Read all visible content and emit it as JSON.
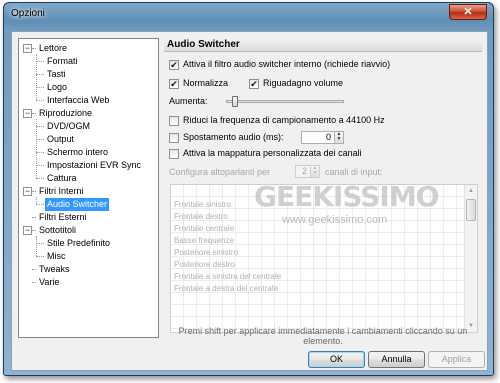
{
  "window": {
    "title": "Opzioni",
    "close_glyph": "✕"
  },
  "tree": {
    "items": [
      {
        "label": "Lettore",
        "level": 0,
        "expanded": true
      },
      {
        "label": "Formati",
        "level": 1
      },
      {
        "label": "Tasti",
        "level": 1
      },
      {
        "label": "Logo",
        "level": 1
      },
      {
        "label": "Interfaccia Web",
        "level": 1
      },
      {
        "label": "Riproduzione",
        "level": 0,
        "expanded": true
      },
      {
        "label": "DVD/OGM",
        "level": 1
      },
      {
        "label": "Output",
        "level": 1
      },
      {
        "label": "Schermo intero",
        "level": 1
      },
      {
        "label": "Impostazioni EVR Sync",
        "level": 1
      },
      {
        "label": "Cattura",
        "level": 1
      },
      {
        "label": "Filtri Interni",
        "level": 0,
        "expanded": true
      },
      {
        "label": "Audio Switcher",
        "level": 1,
        "selected": true
      },
      {
        "label": "Filtri Esterni",
        "level": 0
      },
      {
        "label": "Sottotitoli",
        "level": 0,
        "expanded": true
      },
      {
        "label": "Stile Predefinito",
        "level": 1
      },
      {
        "label": "Misc",
        "level": 1
      },
      {
        "label": "Tweaks",
        "level": 0
      },
      {
        "label": "Varie",
        "level": 0
      }
    ]
  },
  "panel": {
    "title": "Audio Switcher",
    "enable_filter": {
      "label": "Attiva il filtro audio switcher interno (richiede riavvio)",
      "checked": true
    },
    "normalize": {
      "label": "Normalizza",
      "checked": true
    },
    "regain": {
      "label": "Riguadagno volume",
      "checked": true
    },
    "boost_label": "Aumenta:",
    "boost_level": 0.08,
    "downsample": {
      "label": "Riduci la frequenza di campionamento a 44100 Hz",
      "checked": false
    },
    "shift": {
      "label": "Spostamento audio (ms):",
      "checked": false,
      "value": "0"
    },
    "custom_mapping": {
      "label": "Attiva la mappatura personalizzata dei canali",
      "checked": false
    },
    "config_label_left": "Configura altoparlanti per",
    "config_value": "2",
    "config_label_right": "canali di input:",
    "channels": [
      "Frontale sinistro",
      "Frontale destro",
      "Frontale centrale",
      "Basse frequenze",
      "Posteriore sinistro",
      "Posteriore destro",
      "Frontale a sinistra del centrale",
      "Frontale a destra del centrale"
    ],
    "hint": "Premi shift per applicare immediatamente i cambiamenti cliccando su un elemento.",
    "watermark": "GEEKISSIMO",
    "watermark_url": "www.geekissimo.com"
  },
  "buttons": {
    "ok": "OK",
    "cancel": "Annulla",
    "apply": "Applica"
  }
}
